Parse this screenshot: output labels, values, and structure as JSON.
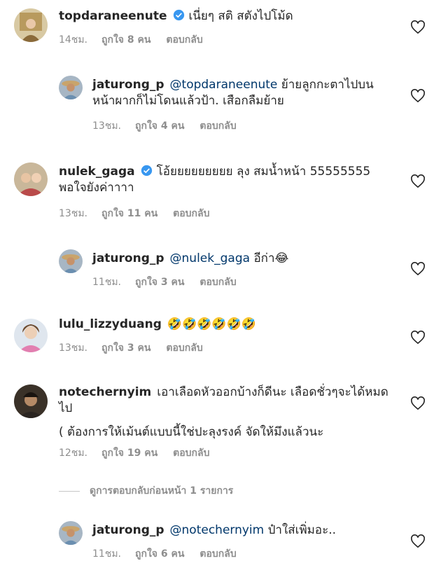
{
  "comments": [
    {
      "username": "topdaraneenute",
      "verified": true,
      "mention": "",
      "text": "เนี่ยๆ สติ สตังไปโม้ด",
      "time": "14ชม.",
      "likes": "ถูกใจ 8 คน",
      "reply": "ตอบกลับ"
    },
    {
      "username": "jaturong_p",
      "verified": false,
      "mention": "@topdaraneenute",
      "text": "ย้ายลูกกะตาไปบนหน้าผากก็ไม่โดนแล้วป้า. เสือกลืมย้าย",
      "time": "13ชม.",
      "likes": "ถูกใจ 4 คน",
      "reply": "ตอบกลับ"
    },
    {
      "username": "nulek_gaga",
      "verified": true,
      "mention": "",
      "text": "โอ้ยยยยยยยยย ลุง สมน้ำหน้า 55555555 พอใจยังค่าาาา",
      "time": "13ชม.",
      "likes": "ถูกใจ 11 คน",
      "reply": "ตอบกลับ"
    },
    {
      "username": "jaturong_p",
      "verified": false,
      "mention": "@nulek_gaga",
      "text": "อีก่า😂",
      "time": "11ชม.",
      "likes": "ถูกใจ 3 คน",
      "reply": "ตอบกลับ"
    },
    {
      "username": "lulu_lizzyduang",
      "verified": false,
      "mention": "",
      "text": "🤣🤣🤣🤣🤣🤣",
      "time": "13ชม.",
      "likes": "ถูกใจ 3 คน",
      "reply": "ตอบกลับ"
    },
    {
      "username": "notechernyim",
      "verified": false,
      "mention": "",
      "text": "เอาเลือดหัวออกบ้างก็ดีนะ เลือดชั่วๆจะได้หมดไป",
      "text2": "( ต้องการให้เม้นต์แบบนี้ใช่ปะลุงรงค์ จัดให้มึงแล้วนะ",
      "time": "12ชม.",
      "likes": "ถูกใจ 19 คน",
      "reply": "ตอบกลับ"
    },
    {
      "username": "jaturong_p",
      "verified": false,
      "mention": "@notechernyim",
      "text": "ป๋าใส่เพิ่มอะ..",
      "time": "11ชม.",
      "likes": "ถูกใจ 6 คน",
      "reply": "ตอบกลับ"
    }
  ],
  "view_replies": "ดูการตอบกลับก่อนหน้า 1 รายการ",
  "colors": {
    "text": "#262626",
    "secondary": "#8e8e8e",
    "mention": "#00376b",
    "verified": "#3897f0"
  },
  "icons": {
    "heart": "heart-outline-icon",
    "verified": "verified-badge-icon"
  }
}
